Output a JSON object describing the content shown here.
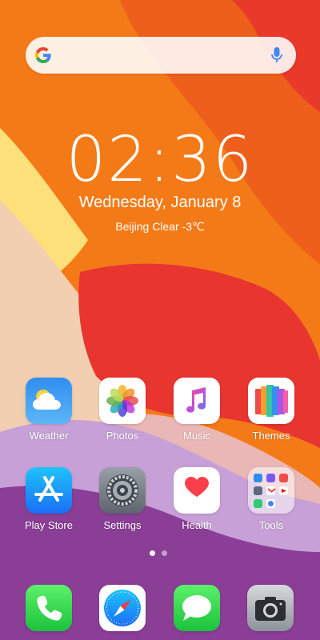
{
  "wallpaper": {
    "colors": {
      "orange": "#f47a18",
      "deep_orange": "#ef5a1b",
      "red": "#e8352f",
      "yellow": "#fde07a",
      "beige": "#f1cfb0",
      "pink": "#e9b7b5",
      "lavender": "#c7a0d8",
      "purple": "#8a3e96"
    }
  },
  "search": {
    "logo_icon": "google-g-icon",
    "mic_icon": "microphone-icon"
  },
  "clock": {
    "time": "02:36",
    "date": "Wednesday, January 8",
    "weather": "Beijing  Clear  -3℃"
  },
  "apps": [
    {
      "label": "Weather",
      "icon": "weather-icon"
    },
    {
      "label": "Photos",
      "icon": "photos-icon"
    },
    {
      "label": "Music",
      "icon": "music-icon"
    },
    {
      "label": "Themes",
      "icon": "themes-icon"
    },
    {
      "label": "Play Store",
      "icon": "app-store-icon"
    },
    {
      "label": "Settings",
      "icon": "settings-gear-icon"
    },
    {
      "label": "Health",
      "icon": "health-heart-icon"
    },
    {
      "label": "Tools",
      "icon": "tools-folder-icon"
    }
  ],
  "page_indicator": {
    "pages": 2,
    "current": 1
  },
  "dock": [
    {
      "icon": "phone-icon"
    },
    {
      "icon": "safari-compass-icon"
    },
    {
      "icon": "messages-icon"
    },
    {
      "icon": "camera-icon"
    }
  ]
}
